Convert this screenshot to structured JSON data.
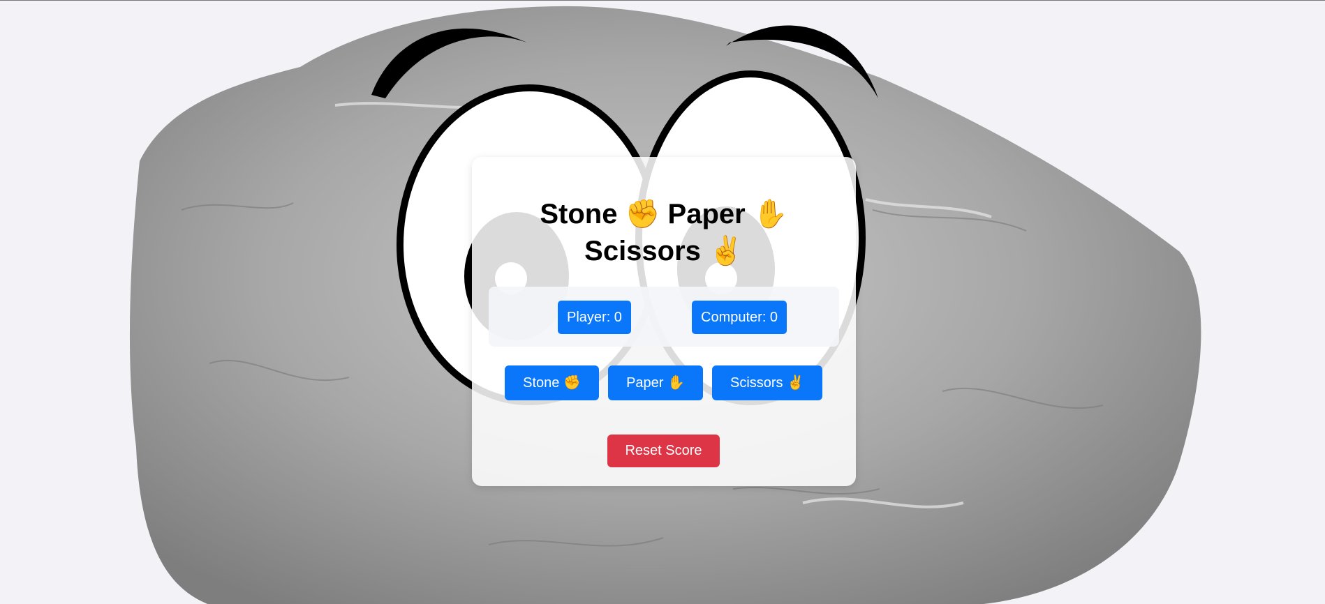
{
  "game": {
    "title_line1": "Stone ✊ Paper ✋",
    "title_line2": "Scissors ✌️",
    "score": {
      "player_label": "Player: 0",
      "computer_label": "Computer: 0"
    },
    "choices": {
      "stone_label": "Stone ✊",
      "paper_label": "Paper ✋",
      "scissors_label": "Scissors ✌️"
    },
    "reset_label": "Reset Score"
  },
  "colors": {
    "primary": "#0a77fb",
    "danger": "#dd3545",
    "background": "#f3f3f7",
    "rock": "#9a9a9a"
  }
}
